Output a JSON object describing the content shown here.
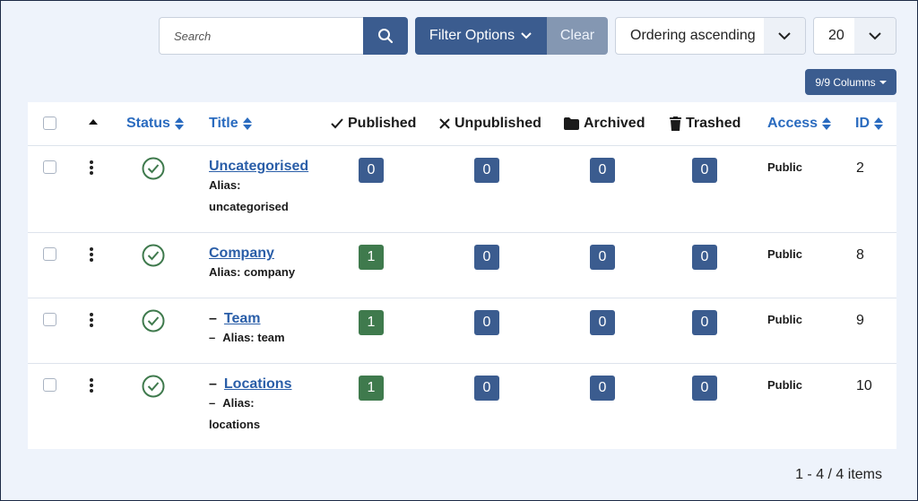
{
  "toolbar": {
    "search_placeholder": "Search",
    "filter_label": "Filter Options",
    "clear_label": "Clear",
    "ordering_value": "Ordering ascending",
    "limit_value": "20",
    "columns_label": "9/9 Columns"
  },
  "table": {
    "headers": {
      "status": "Status",
      "title": "Title",
      "published": "Published",
      "unpublished": "Unpublished",
      "archived": "Archived",
      "trashed": "Trashed",
      "access": "Access",
      "id": "ID"
    },
    "rows": [
      {
        "title": "Uncategorised",
        "alias_label": "Alias:",
        "alias": "uncategorised",
        "published": "0",
        "unpublished": "0",
        "archived": "0",
        "trashed": "0",
        "access": "Public",
        "id": "2"
      },
      {
        "title": "Company",
        "alias_label": "Alias: company",
        "published": "1",
        "unpublished": "0",
        "archived": "0",
        "trashed": "0",
        "access": "Public",
        "id": "8"
      },
      {
        "title": "Team",
        "alias_label": "Alias: team",
        "dash": "–",
        "published": "1",
        "unpublished": "0",
        "archived": "0",
        "trashed": "0",
        "access": "Public",
        "id": "9"
      },
      {
        "title": "Locations",
        "alias_label": "Alias:",
        "alias": "locations",
        "dash": "–",
        "published": "1",
        "unpublished": "0",
        "archived": "0",
        "trashed": "0",
        "access": "Public",
        "id": "10"
      }
    ]
  },
  "pagination": {
    "info": "1 - 4 / 4 items"
  },
  "colors": {
    "primary": "#3b5c8f",
    "success": "#3f7a4d",
    "link": "#2a6bbf",
    "secondary": "#8497b2"
  }
}
